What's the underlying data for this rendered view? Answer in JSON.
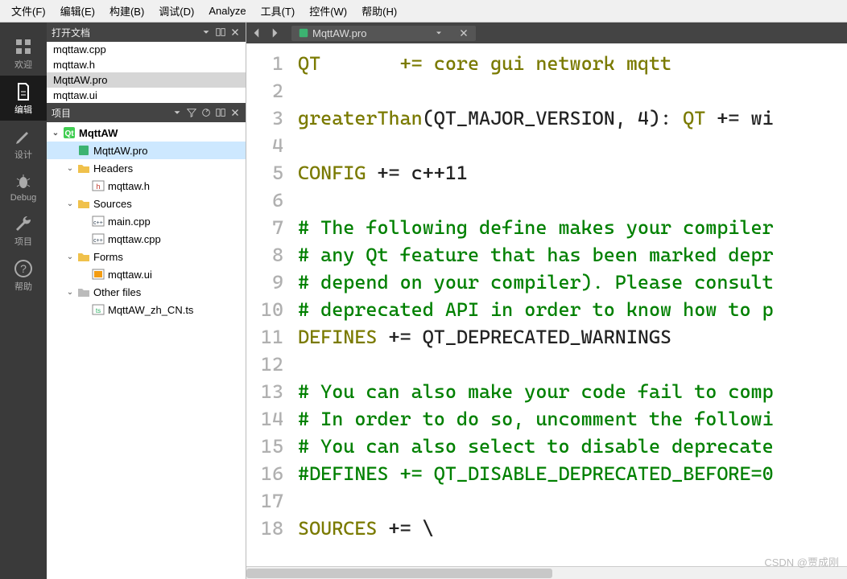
{
  "menubar": [
    {
      "label": "文件(F)"
    },
    {
      "label": "编辑(E)"
    },
    {
      "label": "构建(B)"
    },
    {
      "label": "调试(D)"
    },
    {
      "label": "Analyze"
    },
    {
      "label": "工具(T)"
    },
    {
      "label": "控件(W)"
    },
    {
      "label": "帮助(H)"
    }
  ],
  "leftbar": [
    {
      "label": "欢迎",
      "icon": "grid"
    },
    {
      "label": "编辑",
      "icon": "doc",
      "active": true
    },
    {
      "label": "设计",
      "icon": "pencil"
    },
    {
      "label": "Debug",
      "icon": "bug"
    },
    {
      "label": "项目",
      "icon": "wrench"
    },
    {
      "label": "帮助",
      "icon": "help"
    }
  ],
  "open_docs": {
    "title": "打开文档",
    "items": [
      {
        "name": "mqttaw.cpp"
      },
      {
        "name": "mqttaw.h"
      },
      {
        "name": "MqttAW.pro",
        "active": true
      },
      {
        "name": "mqttaw.ui"
      }
    ]
  },
  "project_panel": {
    "title": "项目",
    "tree": [
      {
        "depth": 0,
        "label": "MqttAW",
        "icon": "qt",
        "expanded": true,
        "bold": true
      },
      {
        "depth": 1,
        "label": "MqttAW.pro",
        "icon": "pro",
        "selected": true
      },
      {
        "depth": 1,
        "label": "Headers",
        "icon": "folder",
        "expanded": true
      },
      {
        "depth": 2,
        "label": "mqttaw.h",
        "icon": "h"
      },
      {
        "depth": 1,
        "label": "Sources",
        "icon": "folder",
        "expanded": true
      },
      {
        "depth": 2,
        "label": "main.cpp",
        "icon": "cpp"
      },
      {
        "depth": 2,
        "label": "mqttaw.cpp",
        "icon": "cpp"
      },
      {
        "depth": 1,
        "label": "Forms",
        "icon": "folder",
        "expanded": true
      },
      {
        "depth": 2,
        "label": "mqttaw.ui",
        "icon": "ui"
      },
      {
        "depth": 1,
        "label": "Other files",
        "icon": "genfolder",
        "expanded": true
      },
      {
        "depth": 2,
        "label": "MqttAW_zh_CN.ts",
        "icon": "ts"
      }
    ]
  },
  "editor": {
    "tab": {
      "name": "MqttAW.pro",
      "icon": "pro"
    },
    "lines": [
      [
        {
          "t": "QT       += core gui network mqtt",
          "c": "kw"
        }
      ],
      [],
      [
        {
          "t": "greaterThan",
          "c": "kw"
        },
        {
          "t": "(QT_MAJOR_VERSION, 4): "
        },
        {
          "t": "QT",
          "c": "kw"
        },
        {
          "t": " += wi"
        }
      ],
      [],
      [
        {
          "t": "CONFIG",
          "c": "kw"
        },
        {
          "t": " += c++11"
        }
      ],
      [],
      [
        {
          "t": "# The following define makes your compiler",
          "c": "comment"
        }
      ],
      [
        {
          "t": "# any Qt feature that has been marked depr",
          "c": "comment"
        }
      ],
      [
        {
          "t": "# depend on your compiler). Please consult",
          "c": "comment"
        }
      ],
      [
        {
          "t": "# deprecated API in order to know how to p",
          "c": "comment"
        }
      ],
      [
        {
          "t": "DEFINES",
          "c": "kw"
        },
        {
          "t": " += QT_DEPRECATED_WARNINGS"
        }
      ],
      [],
      [
        {
          "t": "# You can also make your code fail to comp",
          "c": "comment"
        }
      ],
      [
        {
          "t": "# In order to do so, uncomment the followi",
          "c": "comment"
        }
      ],
      [
        {
          "t": "# You can also select to disable deprecate",
          "c": "comment"
        }
      ],
      [
        {
          "t": "#DEFINES += QT_DISABLE_DEPRECATED_BEFORE=0",
          "c": "comment"
        }
      ],
      [],
      [
        {
          "t": "SOURCES",
          "c": "kw"
        },
        {
          "t": " += \\\\"
        }
      ]
    ]
  },
  "watermark": "CSDN @贾成刚"
}
